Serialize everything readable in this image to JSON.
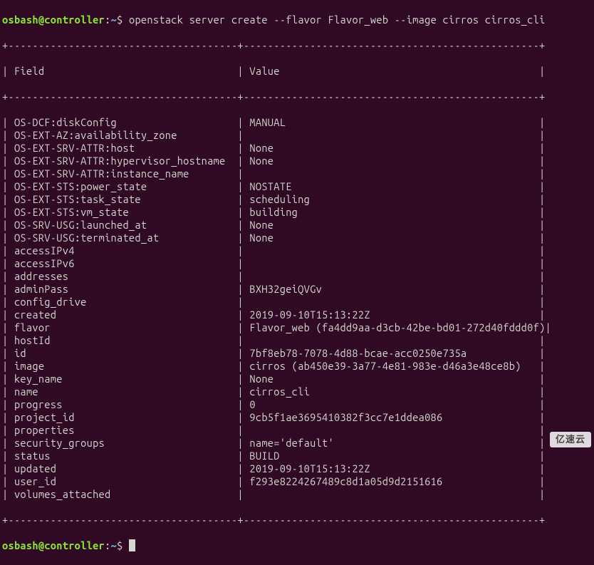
{
  "prompt": {
    "user_host": "osbash@controller",
    "path": "~",
    "command": "openstack server create --flavor Flavor_web --image cirros cirros_cli"
  },
  "table": {
    "border_top": "+--------------------------------------+-------------------------------------------------+",
    "border_sep": "+--------------------------------------+-------------------------------------------------+",
    "border_bot": "+--------------------------------------+-------------------------------------------------+",
    "header": {
      "field": "Field",
      "value": "Value"
    },
    "rows": [
      {
        "field": "OS-DCF:diskConfig",
        "value": "MANUAL"
      },
      {
        "field": "OS-EXT-AZ:availability_zone",
        "value": ""
      },
      {
        "field": "OS-EXT-SRV-ATTR:host",
        "value": "None"
      },
      {
        "field": "OS-EXT-SRV-ATTR:hypervisor_hostname",
        "value": "None"
      },
      {
        "field": "OS-EXT-SRV-ATTR:instance_name",
        "value": ""
      },
      {
        "field": "OS-EXT-STS:power_state",
        "value": "NOSTATE"
      },
      {
        "field": "OS-EXT-STS:task_state",
        "value": "scheduling"
      },
      {
        "field": "OS-EXT-STS:vm_state",
        "value": "building"
      },
      {
        "field": "OS-SRV-USG:launched_at",
        "value": "None"
      },
      {
        "field": "OS-SRV-USG:terminated_at",
        "value": "None"
      },
      {
        "field": "accessIPv4",
        "value": ""
      },
      {
        "field": "accessIPv6",
        "value": ""
      },
      {
        "field": "addresses",
        "value": ""
      },
      {
        "field": "adminPass",
        "value": "BXH32geiQVGv"
      },
      {
        "field": "config_drive",
        "value": ""
      },
      {
        "field": "created",
        "value": "2019-09-10T15:13:22Z"
      },
      {
        "field": "flavor",
        "value": "Flavor_web (fa4dd9aa-d3cb-42be-bd01-272d40fddd0f)"
      },
      {
        "field": "hostId",
        "value": ""
      },
      {
        "field": "id",
        "value": "7bf8eb78-7078-4d88-bcae-acc0250e735a"
      },
      {
        "field": "image",
        "value": "cirros (ab450e39-3a77-4e81-983e-d46a3e48ce8b)"
      },
      {
        "field": "key_name",
        "value": "None"
      },
      {
        "field": "name",
        "value": "cirros_cli"
      },
      {
        "field": "progress",
        "value": "0"
      },
      {
        "field": "project_id",
        "value": "9cb5f1ae3695410382f3cc7e1ddea086"
      },
      {
        "field": "properties",
        "value": ""
      },
      {
        "field": "security_groups",
        "value": "name='default'"
      },
      {
        "field": "status",
        "value": "BUILD"
      },
      {
        "field": "updated",
        "value": "2019-09-10T15:13:22Z"
      },
      {
        "field": "user_id",
        "value": "f293e8224267489c8d1a05d9d2151616"
      },
      {
        "field": "volumes_attached",
        "value": ""
      }
    ]
  },
  "watermark": "亿速云",
  "field_col_width": 37,
  "value_col_width": 48
}
